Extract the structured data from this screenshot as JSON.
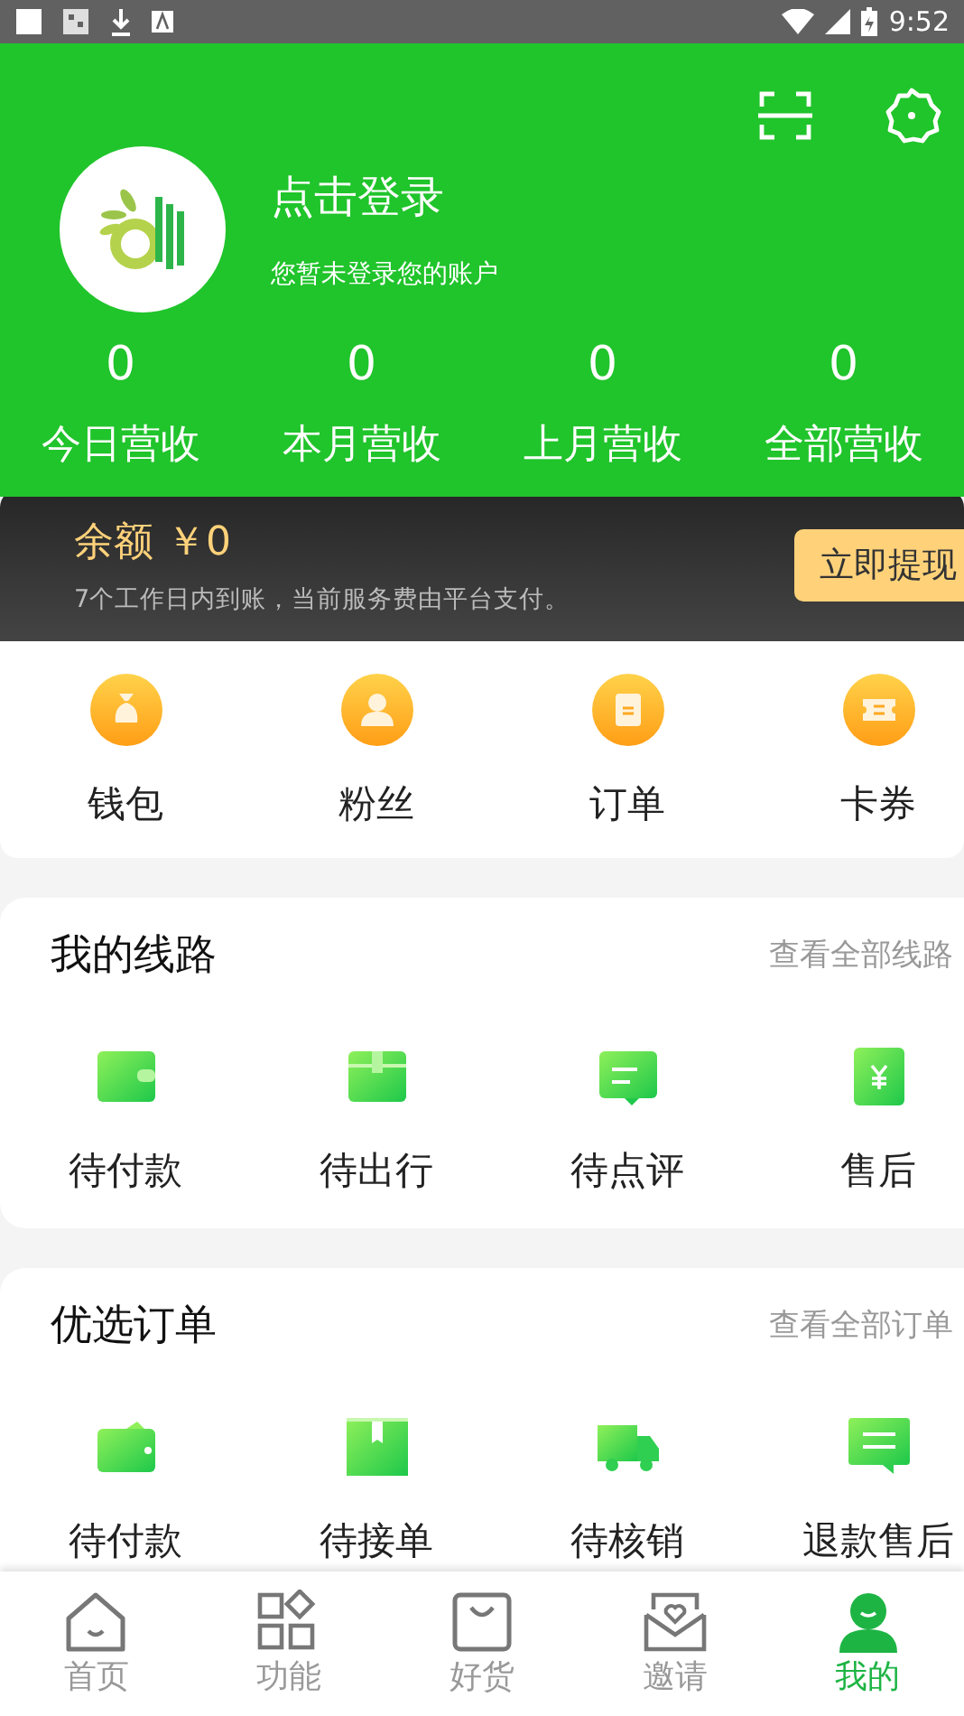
{
  "status_bar": {
    "time": "9:52"
  },
  "header": {
    "login_title": "点击登录",
    "login_subtitle": "您暂未登录您的账户"
  },
  "stats": [
    {
      "value": "0",
      "label": "今日营收"
    },
    {
      "value": "0",
      "label": "本月营收"
    },
    {
      "value": "0",
      "label": "上月营收"
    },
    {
      "value": "0",
      "label": "全部营收"
    }
  ],
  "balance": {
    "label": "余额 ￥0",
    "note": "7个工作日内到账，当前服务费由平台支付。",
    "button": "立即提现"
  },
  "quick_links": [
    {
      "kind": "wallet",
      "label": "钱包"
    },
    {
      "kind": "fans",
      "label": "粉丝"
    },
    {
      "kind": "order",
      "label": "订单"
    },
    {
      "kind": "coupon",
      "label": "卡券"
    }
  ],
  "sections": [
    {
      "title": "我的线路",
      "link": "查看全部线路",
      "items": [
        {
          "kind": "wallet",
          "label": "待付款"
        },
        {
          "kind": "box",
          "label": "待出行"
        },
        {
          "kind": "comment",
          "label": "待点评"
        },
        {
          "kind": "refund",
          "label": "售后"
        }
      ]
    },
    {
      "title": "优选订单",
      "link": "查看全部订单",
      "items": [
        {
          "kind": "wallet2",
          "label": "待付款"
        },
        {
          "kind": "box2",
          "label": "待接单"
        },
        {
          "kind": "truck",
          "label": "待核销"
        },
        {
          "kind": "comment2",
          "label": "退款售后"
        }
      ]
    }
  ],
  "tabbar": [
    {
      "kind": "home",
      "label": "首页",
      "selected": false
    },
    {
      "kind": "grid",
      "label": "功能",
      "selected": false
    },
    {
      "kind": "bag",
      "label": "好货",
      "selected": false
    },
    {
      "kind": "mail",
      "label": "邀请",
      "selected": false
    },
    {
      "kind": "person",
      "label": "我的",
      "selected": true
    }
  ]
}
